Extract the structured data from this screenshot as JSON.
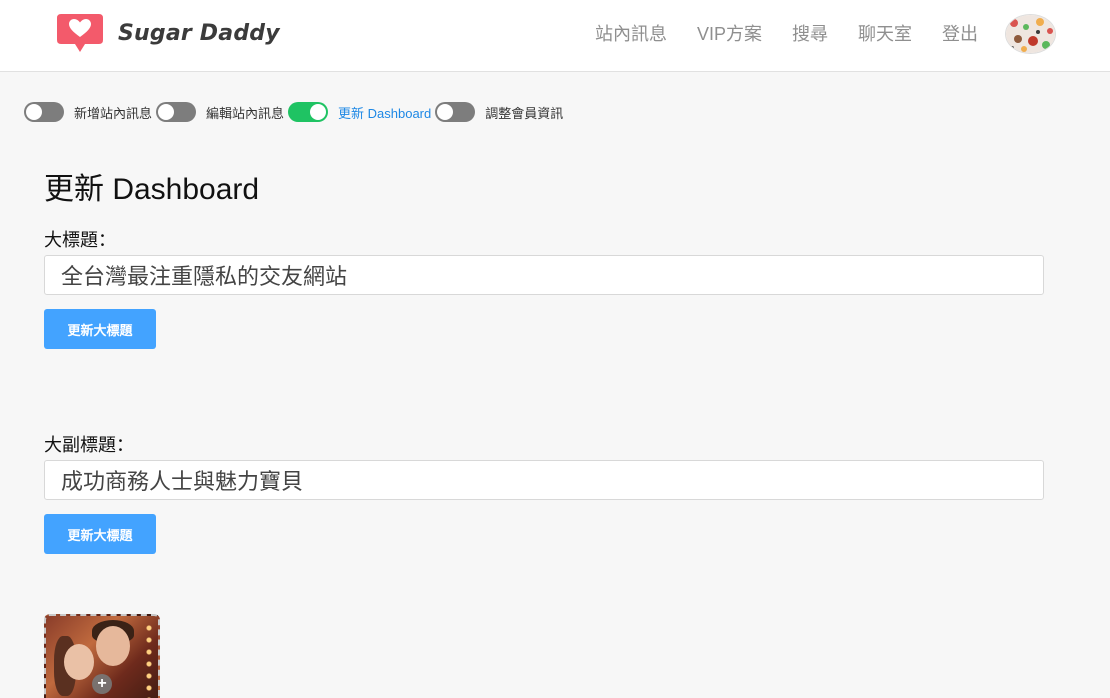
{
  "brand": {
    "name": "Sugar Daddy",
    "logo_icon": "heart-chat-bubble-icon",
    "accent": "#f35a6b"
  },
  "nav": {
    "items": [
      {
        "label": "站內訊息"
      },
      {
        "label": "VIP方案"
      },
      {
        "label": "搜尋"
      },
      {
        "label": "聊天室"
      },
      {
        "label": "登出"
      }
    ],
    "avatar_icon": "user-avatar-icon"
  },
  "toggles": [
    {
      "label": "新增站內訊息",
      "on": false
    },
    {
      "label": "編輯站內訊息",
      "on": false
    },
    {
      "label": "更新 Dashboard",
      "on": true
    },
    {
      "label": "調整會員資訊",
      "on": false
    }
  ],
  "page": {
    "title": "更新 Dashboard"
  },
  "form": {
    "headline": {
      "label": "大標題：",
      "value": "全台灣最注重隱私的交友網站",
      "button": "更新大標題"
    },
    "subheadline": {
      "label": "大副標題：",
      "value": "成功商務人士與魅力寶貝",
      "button": "更新大標題"
    }
  },
  "photo": {
    "add_icon": "plus-icon",
    "add_glyph": "+"
  },
  "colors": {
    "primary_button": "#43a3ff",
    "toggle_on": "#1fc363",
    "toggle_off": "#7d7d7d",
    "active_link": "#1e88e5"
  }
}
